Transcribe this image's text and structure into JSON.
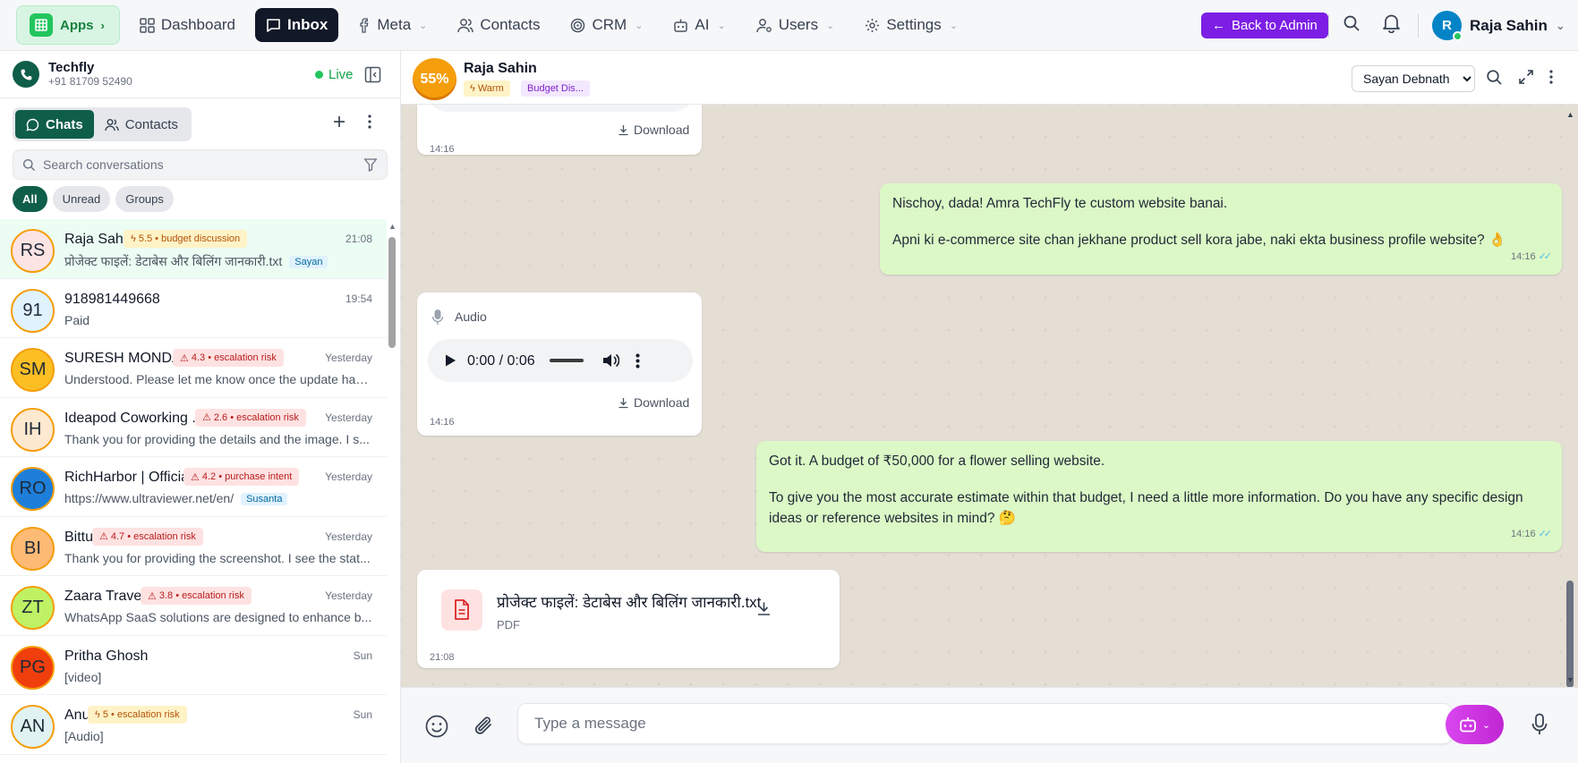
{
  "nav": {
    "apps_label": "Apps",
    "items": [
      {
        "label": "Dashboard"
      },
      {
        "label": "Inbox"
      },
      {
        "label": "Meta"
      },
      {
        "label": "Contacts"
      },
      {
        "label": "CRM"
      },
      {
        "label": "AI"
      },
      {
        "label": "Users"
      },
      {
        "label": "Settings"
      }
    ],
    "back_to_admin": "Back to Admin",
    "user_initial": "R",
    "user_name": "Raja Sahin"
  },
  "account": {
    "name": "Techfly",
    "phone": "+91 81709 52490",
    "status": "Live"
  },
  "sidebar": {
    "tabs": [
      {
        "label": "Chats"
      },
      {
        "label": "Contacts"
      }
    ],
    "search_placeholder": "Search conversations",
    "filters": [
      {
        "label": "All"
      },
      {
        "label": "Unread"
      },
      {
        "label": "Groups"
      }
    ],
    "conversations": [
      {
        "initials": "RS",
        "name": "Raja Sahin",
        "badge": "5.5 • budget discussion",
        "badge_type": "yellow",
        "time": "21:08",
        "preview": "प्रोजेक्ट फाइलें: डेटाबेस और बिलिंग जानकारी.txt",
        "agent": "Sayan",
        "av_bg": "#fde4e4",
        "selected": true
      },
      {
        "initials": "91",
        "name": "918981449668",
        "badge": "",
        "badge_type": "",
        "time": "19:54",
        "preview": "Paid",
        "agent": "",
        "av_bg": "#e0f2fe",
        "selected": false
      },
      {
        "initials": "SM",
        "name": "SURESH MONDAL",
        "badge": "4.3 • escalation risk",
        "badge_type": "red",
        "time": "Yesterday",
        "preview": "Understood. Please let me know once the update has ...",
        "agent": "",
        "av_bg": "#fbbf24",
        "selected": false
      },
      {
        "initials": "IH",
        "name": "Ideapod Coworking ...",
        "badge": "2.6 • escalation risk",
        "badge_type": "red",
        "time": "Yesterday",
        "preview": "Thank you for providing the details and the image. I s...",
        "agent": "",
        "av_bg": "#fde8d0",
        "selected": false
      },
      {
        "initials": "RO",
        "name": "RichHarbor | Official",
        "badge": "4.2 • purchase intent",
        "badge_type": "red",
        "time": "Yesterday",
        "preview": "https://www.ultraviewer.net/en/",
        "agent": "Susanta",
        "av_bg": "#1d7fd9",
        "selected": false
      },
      {
        "initials": "BI",
        "name": "Bittu",
        "badge": "4.7 • escalation risk",
        "badge_type": "red",
        "time": "Yesterday",
        "preview": "Thank you for providing the screenshot. I see the stat...",
        "agent": "",
        "av_bg": "#fdba74",
        "selected": false
      },
      {
        "initials": "ZT",
        "name": "Zaara Travels",
        "badge": "3.8 • escalation risk",
        "badge_type": "red",
        "time": "Yesterday",
        "preview": "WhatsApp SaaS solutions are designed to enhance b...",
        "agent": "",
        "av_bg": "#bef264",
        "selected": false
      },
      {
        "initials": "PG",
        "name": "Pritha Ghosh",
        "badge": "",
        "badge_type": "",
        "time": "Sun",
        "preview": "[video]",
        "agent": "",
        "av_bg": "#f03e0c",
        "selected": false
      },
      {
        "initials": "AN",
        "name": "Anu",
        "badge": "5 • escalation risk",
        "badge_type": "yellow",
        "time": "Sun",
        "preview": "[Audio]",
        "agent": "",
        "av_bg": "#e0f2f1",
        "selected": false
      }
    ]
  },
  "chat_header": {
    "score": "55%",
    "name": "Raja Sahin",
    "tag_warm": "Warm",
    "tag_topic": "Budget Dis...",
    "agent_options": [
      "Sayan Debnath"
    ],
    "agent_selected": "Sayan Debnath"
  },
  "messages": {
    "m1": {
      "download": "Download",
      "time": "14:16"
    },
    "m2": {
      "line1": "Nischoy, dada! Amra TechFly te custom website banai.",
      "line2": "Apni ki e-commerce site chan jekhane product sell kora jabe, naki ekta business profile website? 👌",
      "time": "14:16"
    },
    "m3": {
      "label": "Audio",
      "player_time": "0:00 / 0:06",
      "download": "Download",
      "time": "14:16"
    },
    "m4": {
      "line1": "Got it. A budget of ₹50,000 for a flower selling website.",
      "line2": "To give you the most accurate estimate within that budget, I need a little more information. Do you have any specific design ideas or reference websites in mind? 🤔",
      "time": "14:16"
    },
    "m5": {
      "file_name": "प्रोजेक्ट फाइलें: डेटाबेस और बिलिंग जानकारी.txt",
      "file_type": "PDF",
      "time": "21:08"
    }
  },
  "composer": {
    "placeholder": "Type a message"
  },
  "colors": {
    "brand": "#0f5e49",
    "admin_button": "#7c1ee4",
    "outgoing_bubble": "#dcf8c6",
    "chat_background": "#efeae2"
  }
}
